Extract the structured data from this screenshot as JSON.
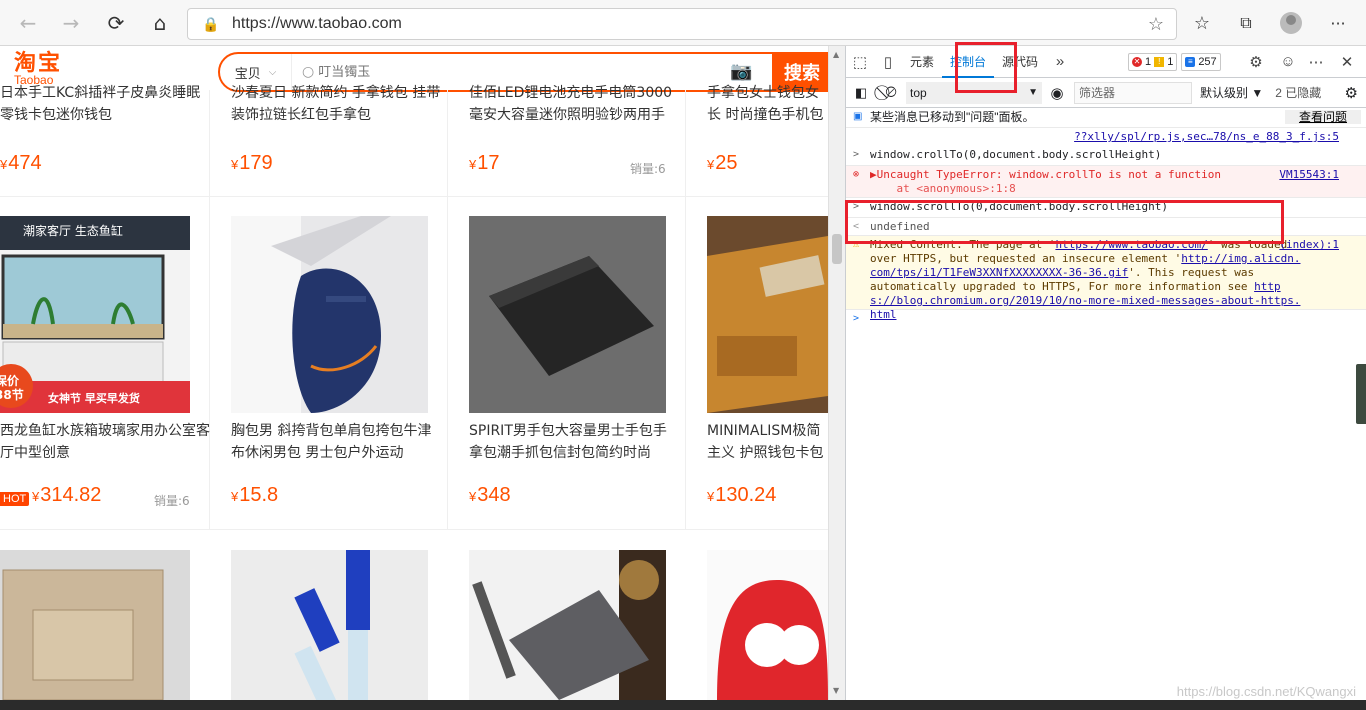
{
  "browser": {
    "url": "https://www.taobao.com",
    "nav": {
      "back": "←",
      "forward": "→",
      "reload": "⟳",
      "home": "⌂"
    },
    "menu": "···"
  },
  "taobao": {
    "logo_zh": "淘宝",
    "logo_en": "Taobao",
    "scope": "宝贝",
    "placeholder": "叮当镯玉",
    "search_btn": "搜索"
  },
  "products": [
    {
      "title": "日本手工KC斜插袢子皮鼻炎睡眠零钱卡包迷你钱包",
      "price": "474",
      "sales": ""
    },
    {
      "title": "沙春夏日 新款简约 手拿钱包 挂带装饰拉链长红包手拿包",
      "price": "179",
      "sales": ""
    },
    {
      "title": "佳佰LED锂电池充电手电筒3000毫安大容量迷你照明验钞两用手",
      "price": "17",
      "sales": "销量:6"
    },
    {
      "title": "手拿包女士钱包女长 时尚撞色手机包卡包",
      "price": "25",
      "sales": ""
    },
    {
      "title": "西龙鱼缸水族箱玻璃家用办公室客厅中型创意",
      "price": "314.82",
      "sales": "销量:6",
      "hot": "HOT"
    },
    {
      "title": "胸包男 斜挎背包单肩包挎包牛津布休闲男包 男士包户外运动",
      "price": "15.8",
      "sales": ""
    },
    {
      "title": "SPIRIT男手包大容量男士手包手拿包潮手抓包信封包简约时尚",
      "price": "348",
      "sales": ""
    },
    {
      "title": "MINIMALISM极简主义 护照钱包卡包 真皮手包",
      "price": "130.24",
      "sales": ""
    }
  ],
  "currency": "¥",
  "fish_banner": {
    "top": "潮家客厅 生态鱼缸",
    "left": "保价\n38节",
    "right": "女神节 早买早发货"
  },
  "devtools": {
    "tabs": [
      "元素",
      "控制台",
      "源代码"
    ],
    "active_tab": "控制台",
    "errors": "1",
    "warnings": "1",
    "messages": "257",
    "context": "top",
    "filter_placeholder": "筛选器",
    "levels": "默认级别 ▼",
    "hidden": "2 已隐藏",
    "console": {
      "info_text": "某些消息已移动到\"问题\"面板。",
      "info_btn": "查看问题",
      "src1": "??xlly/spl/rp.js,sec…78/ns_e_88_3_f.js:5",
      "cmd1": "window.crollTo(0,document.body.scrollHeight)",
      "err_text": "▶Uncaught TypeError: window.crollTo is not a function",
      "err_sub": "    at <anonymous>:1:8",
      "err_src": "VM15543:1",
      "cmd2": "window.scrollTo(0,document.body.scrollHeight)",
      "result2": "undefined",
      "warn_a": "Mixed Content: The page at '",
      "warn_link1": "https://www.taobao.com/",
      "warn_b": "' was loaded over HTTPS, but requested an insecure element '",
      "warn_link2": "http://img.alicdn.com/tps/i1/T1FeW3XXNfXXXXXXXX-36-36.gif",
      "warn_c": "'. This request was automatically upgraded to HTTPS, For more information see ",
      "warn_link3": "https://blog.chromium.org/2019/10/no-more-mixed-messages-about-https.html",
      "warn_src": "(index):1"
    }
  },
  "watermark": "https://blog.csdn.net/KQwangxi"
}
